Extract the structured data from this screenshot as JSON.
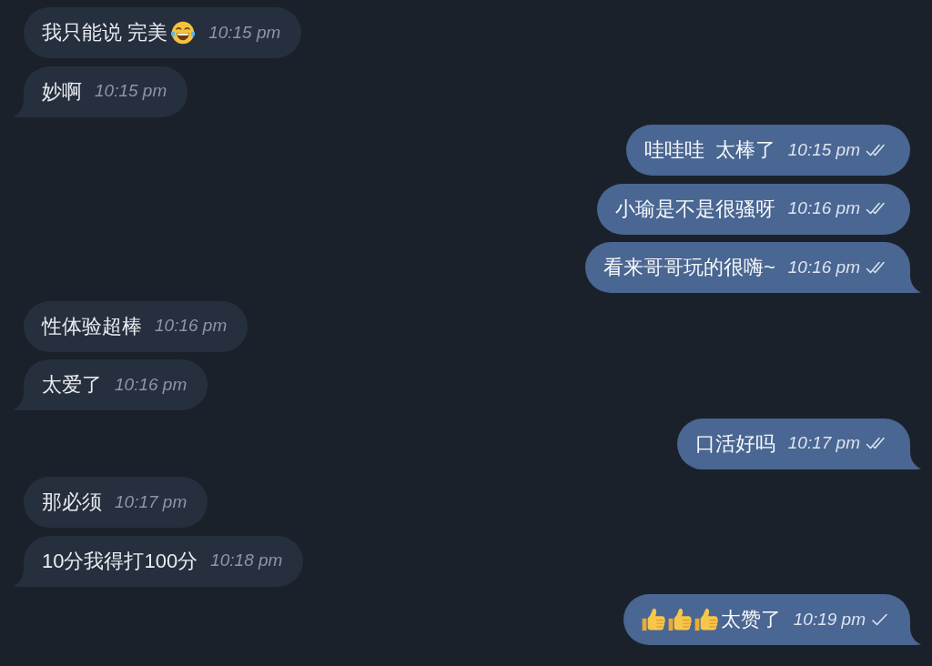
{
  "messages": [
    {
      "kind": "incoming",
      "parts": [
        {
          "kind": "text",
          "text": "我只能说 完美"
        },
        {
          "kind": "laughing_emoji"
        }
      ],
      "time": "10:15 pm"
    },
    {
      "kind": "incoming",
      "parts": [
        {
          "kind": "text",
          "text": "妙啊"
        }
      ],
      "time": "10:15 pm"
    },
    {
      "kind": "outgoing",
      "parts": [
        {
          "kind": "text",
          "text": "哇哇哇  太棒了"
        }
      ],
      "time": "10:15 pm",
      "read": true
    },
    {
      "kind": "outgoing",
      "parts": [
        {
          "kind": "text",
          "text": "小瑜是不是很骚呀"
        }
      ],
      "time": "10:16 pm",
      "read": true
    },
    {
      "kind": "outgoing",
      "parts": [
        {
          "kind": "text",
          "text": "看来哥哥玩的很嗨~"
        }
      ],
      "time": "10:16 pm",
      "read": true
    },
    {
      "kind": "incoming",
      "parts": [
        {
          "kind": "text",
          "text": "性体验超棒"
        }
      ],
      "time": "10:16 pm"
    },
    {
      "kind": "incoming",
      "parts": [
        {
          "kind": "text",
          "text": "太爱了"
        }
      ],
      "time": "10:16 pm"
    },
    {
      "kind": "outgoing",
      "parts": [
        {
          "kind": "text",
          "text": "口活好吗"
        }
      ],
      "time": "10:17 pm",
      "read": true
    },
    {
      "kind": "incoming",
      "parts": [
        {
          "kind": "text",
          "text": "那必须"
        }
      ],
      "time": "10:17 pm"
    },
    {
      "kind": "incoming",
      "parts": [
        {
          "kind": "text",
          "text": "10分我得打100分"
        }
      ],
      "time": "10:18 pm"
    },
    {
      "kind": "outgoing",
      "parts": [
        {
          "kind": "thumbs_up_emoji"
        },
        {
          "kind": "thumbs_up_emoji"
        },
        {
          "kind": "thumbs_up_emoji"
        },
        {
          "kind": "text",
          "text": "太赞了"
        }
      ],
      "time": "10:19 pm",
      "read": false
    }
  ]
}
